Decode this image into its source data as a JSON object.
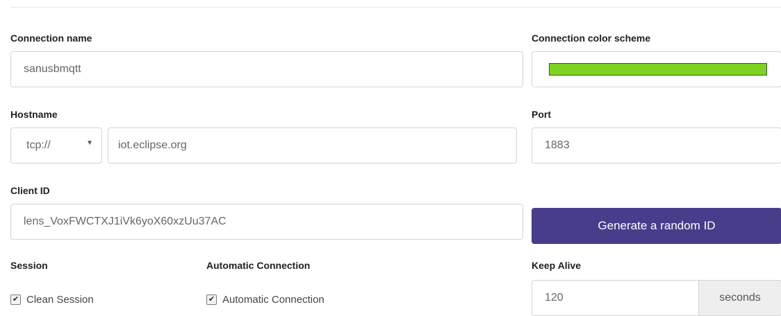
{
  "connection": {
    "name_label": "Connection name",
    "name_value": "sanusbmqtt",
    "color_label": "Connection color scheme",
    "color_hex": "#7ed321"
  },
  "host": {
    "label": "Hostname",
    "protocol": "tcp://",
    "value": "iot.eclipse.org",
    "port_label": "Port",
    "port_value": "1883"
  },
  "client": {
    "label": "Client ID",
    "value": "lens_VoxFWCTXJ1iVk6yoX60xzUu37AC",
    "generate_label": "Generate a random ID"
  },
  "session": {
    "label": "Session",
    "clean_label": "Clean Session",
    "clean_checked": true
  },
  "auto": {
    "label": "Automatic Connection",
    "option_label": "Automatic Connection",
    "checked": true
  },
  "keepalive": {
    "label": "Keep Alive",
    "value": "120",
    "unit": "seconds"
  },
  "icons": {
    "dropdown": "caret-down-icon",
    "check": "checkmark-icon"
  },
  "colors": {
    "primary_button": "#483d8b"
  }
}
